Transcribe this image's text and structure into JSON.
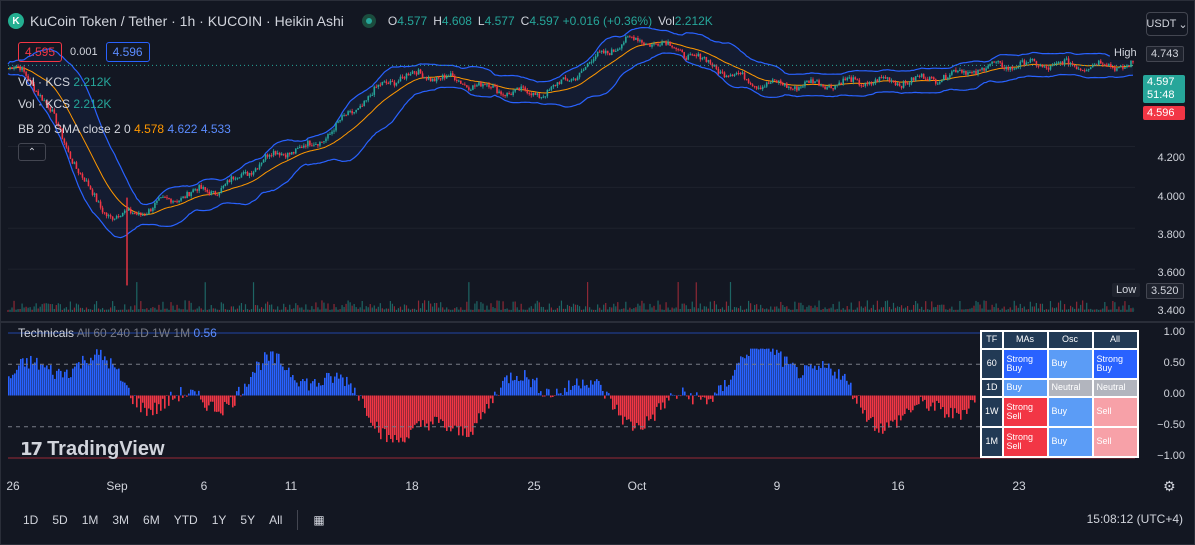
{
  "header": {
    "symbol_title": "KuCoin Token / Tether · 1h · KUCOIN · Heikin Ashi",
    "ohlc": [
      {
        "key": "O",
        "value": "4.577"
      },
      {
        "key": "H",
        "value": "4.608"
      },
      {
        "key": "L",
        "value": "4.577"
      },
      {
        "key": "C",
        "value": "4.597 +0.016 (+0.36%)"
      },
      {
        "key": "Vol",
        "value": "2.212K"
      }
    ],
    "currency": "USDT"
  },
  "trade": {
    "sell_price": "4.595",
    "spread": "0.001",
    "buy_price": "4.596"
  },
  "legends": {
    "vol1_label": "Vol · KCS",
    "vol1_value": "2.212K",
    "vol2_label": "Vol · KCS",
    "vol2_value": "2.212K",
    "bb_label": "BB 20 SMA close 2 0",
    "bb_basis": "4.578",
    "bb_upper": "4.622",
    "bb_lower": "4.533"
  },
  "price_axis": {
    "high_label": "High",
    "high_value": "4.743",
    "low_label": "Low",
    "low_value": "3.520",
    "last_price": "4.597",
    "countdown": "51:48",
    "bid_price": "4.596",
    "ticks": [
      "4.200",
      "4.000",
      "3.800",
      "3.600",
      "3.400"
    ]
  },
  "technicals": {
    "label": "Technicals",
    "params": "All 60 240 1D 1W 1M",
    "value": "0.56",
    "ticks": [
      "1.00",
      "0.50",
      "0.00",
      "−0.50",
      "−1.00"
    ],
    "table": {
      "headers": [
        "TF",
        "MAs",
        "Osc",
        "All"
      ],
      "rows": [
        {
          "tf": "60",
          "mas": "Strong Buy",
          "osc": "Buy",
          "all": "Strong Buy"
        },
        {
          "tf": "1D",
          "mas": "Buy",
          "osc": "Neutral",
          "all": "Neutral"
        },
        {
          "tf": "1W",
          "mas": "Strong Sell",
          "osc": "Buy",
          "all": "Sell"
        },
        {
          "tf": "1M",
          "mas": "Strong Sell",
          "osc": "Buy",
          "all": "Sell"
        }
      ]
    }
  },
  "brand": "TradingView",
  "time_axis": [
    "26",
    "Sep",
    "6",
    "11",
    "18",
    "25",
    "Oct",
    "9",
    "16",
    "23"
  ],
  "range_buttons": [
    "1D",
    "5D",
    "1M",
    "3M",
    "6M",
    "YTD",
    "1Y",
    "5Y",
    "All"
  ],
  "clock": "15:08:12 (UTC+4)",
  "colors": {
    "background": "#131722",
    "up": "#26a69a",
    "down": "#f23645",
    "bb_band": "#2962ff",
    "bb_basis": "#ff9800",
    "tech_positive": "#2962ff",
    "tech_negative": "#f23645"
  },
  "chart_data": {
    "type": "candlestick",
    "title": "KuCoin Token / Tether · 1h · KUCOIN · Heikin Ashi",
    "x_ticks": [
      "26",
      "Sep",
      "6",
      "11",
      "18",
      "25",
      "Oct",
      "9",
      "16",
      "23"
    ],
    "y_ticks": [
      3.4,
      3.6,
      3.8,
      4.0,
      4.2
    ],
    "ylim": [
      3.39,
      4.78
    ],
    "high": 4.743,
    "low": 3.52,
    "last": 4.597,
    "price_path": {
      "x": [
        "26",
        "Sep",
        "6",
        "11",
        "18",
        "25",
        "Oct",
        "9",
        "16",
        "23"
      ],
      "close": [
        4.58,
        3.86,
        3.98,
        4.18,
        4.55,
        4.46,
        4.72,
        4.5,
        4.52,
        4.6
      ]
    },
    "technicals_range": [
      -1.0,
      1.0
    ],
    "technicals_value": 0.56
  }
}
